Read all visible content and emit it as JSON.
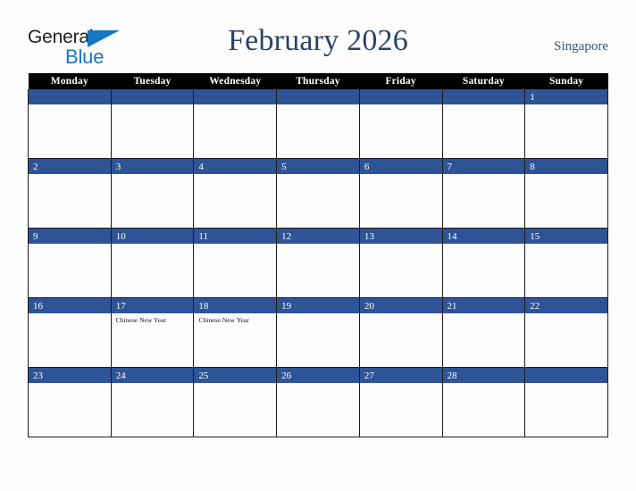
{
  "header": {
    "logo": {
      "text_top": "General",
      "text_bottom": "Blue",
      "triangle_icon": "triangle-icon",
      "brand_color": "#1478c0"
    },
    "title": "February 2026",
    "country": "Singapore"
  },
  "calendar": {
    "accent_color": "#2f5496",
    "header_bg": "#000000",
    "weekdays": [
      "Monday",
      "Tuesday",
      "Wednesday",
      "Thursday",
      "Friday",
      "Saturday",
      "Sunday"
    ],
    "weeks": [
      [
        {
          "day": "",
          "events": []
        },
        {
          "day": "",
          "events": []
        },
        {
          "day": "",
          "events": []
        },
        {
          "day": "",
          "events": []
        },
        {
          "day": "",
          "events": []
        },
        {
          "day": "",
          "events": []
        },
        {
          "day": "1",
          "events": []
        }
      ],
      [
        {
          "day": "2",
          "events": []
        },
        {
          "day": "3",
          "events": []
        },
        {
          "day": "4",
          "events": []
        },
        {
          "day": "5",
          "events": []
        },
        {
          "day": "6",
          "events": []
        },
        {
          "day": "7",
          "events": []
        },
        {
          "day": "8",
          "events": []
        }
      ],
      [
        {
          "day": "9",
          "events": []
        },
        {
          "day": "10",
          "events": []
        },
        {
          "day": "11",
          "events": []
        },
        {
          "day": "12",
          "events": []
        },
        {
          "day": "13",
          "events": []
        },
        {
          "day": "14",
          "events": []
        },
        {
          "day": "15",
          "events": []
        }
      ],
      [
        {
          "day": "16",
          "events": []
        },
        {
          "day": "17",
          "events": [
            "Chinese New Year"
          ]
        },
        {
          "day": "18",
          "events": [
            "Chinese New Year"
          ]
        },
        {
          "day": "19",
          "events": []
        },
        {
          "day": "20",
          "events": []
        },
        {
          "day": "21",
          "events": []
        },
        {
          "day": "22",
          "events": []
        }
      ],
      [
        {
          "day": "23",
          "events": []
        },
        {
          "day": "24",
          "events": []
        },
        {
          "day": "25",
          "events": []
        },
        {
          "day": "26",
          "events": []
        },
        {
          "day": "27",
          "events": []
        },
        {
          "day": "28",
          "events": []
        },
        {
          "day": "",
          "events": []
        }
      ]
    ]
  }
}
